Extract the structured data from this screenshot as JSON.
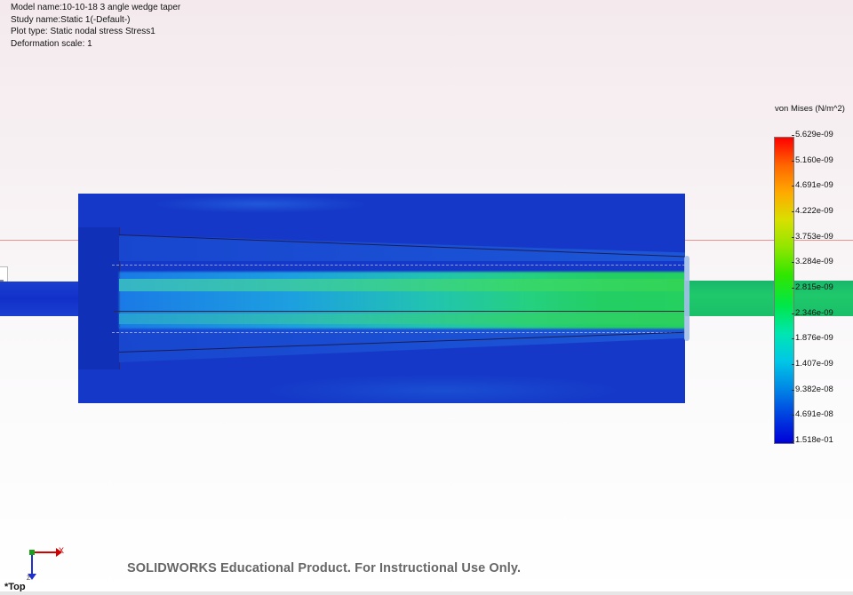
{
  "info": {
    "model_name": "Model name:10-10-18 3 angle wedge taper",
    "study_name": "Study name:Static 1(-Default-)",
    "plot_type": "Plot type: Static nodal stress Stress1",
    "deformation_scale": "Deformation scale: 1"
  },
  "legend": {
    "title": "von Mises (N/m^2)",
    "ticks": [
      "5.629e-09",
      "5.160e-09",
      "4.691e-09",
      "4.222e-09",
      "3.753e-09",
      "3.284e-09",
      "2.815e-09",
      "2.346e-09",
      "1.876e-09",
      "1.407e-09",
      "9.382e-08",
      "4.691e-08",
      "1.518e-01"
    ],
    "colors": {
      "max": "#ff0000",
      "mid": "#30e600",
      "min": "#0000d8"
    }
  },
  "colors": {
    "part_low_stress": "#1538c8",
    "part_high_stress": "#23cf63",
    "reference_line": "#e07a7a"
  },
  "watermark": "SOLIDWORKS Educational Product. For Instructional Use Only.",
  "triad": {
    "x_label": "X",
    "z_label": "Z",
    "icon": "coordinate-triad-icon"
  },
  "view_name": "*Top"
}
